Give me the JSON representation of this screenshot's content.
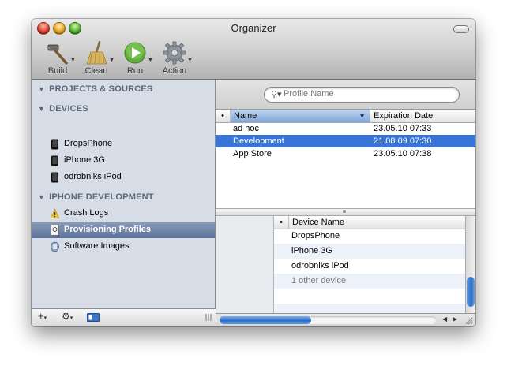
{
  "window": {
    "title": "Organizer"
  },
  "toolbar": {
    "build_label": "Build",
    "clean_label": "Clean",
    "run_label": "Run",
    "action_label": "Action"
  },
  "sidebar": {
    "sections": [
      {
        "label": "PROJECTS & SOURCES"
      },
      {
        "label": "DEVICES"
      },
      {
        "label": "IPHONE DEVELOPMENT"
      }
    ],
    "devices": [
      "DropsPhone",
      "iPhone 3G",
      "odrobniks iPod"
    ],
    "development": [
      "Crash Logs",
      "Provisioning Profiles",
      "Software Images"
    ],
    "selected": "Provisioning Profiles",
    "footer": {
      "add": "+",
      "gear": "⚙",
      "add_caret": "▾",
      "gear_caret": "▾"
    }
  },
  "search": {
    "placeholder": "Profile Name",
    "value": ""
  },
  "profiles": {
    "columns": {
      "bullet": "•",
      "name": "Name",
      "expiration": "Expiration Date"
    },
    "rows": [
      {
        "name": "ad hoc",
        "expiration": "23.05.10 07:33"
      },
      {
        "name": "Development",
        "expiration": "21.08.09 07:30"
      },
      {
        "name": "App Store",
        "expiration": "23.05.10 07:38"
      }
    ],
    "selected_row": 1
  },
  "devices_table": {
    "columns": {
      "bullet": "•",
      "device_name": "Device Name"
    },
    "rows": [
      "DropsPhone",
      "iPhone 3G",
      "odrobniks iPod",
      "1 other device"
    ]
  },
  "colors": {
    "selection_blue": "#3875d7",
    "sidebar_bg": "#d6dde6",
    "sidebar_selected": "#5d7299"
  }
}
